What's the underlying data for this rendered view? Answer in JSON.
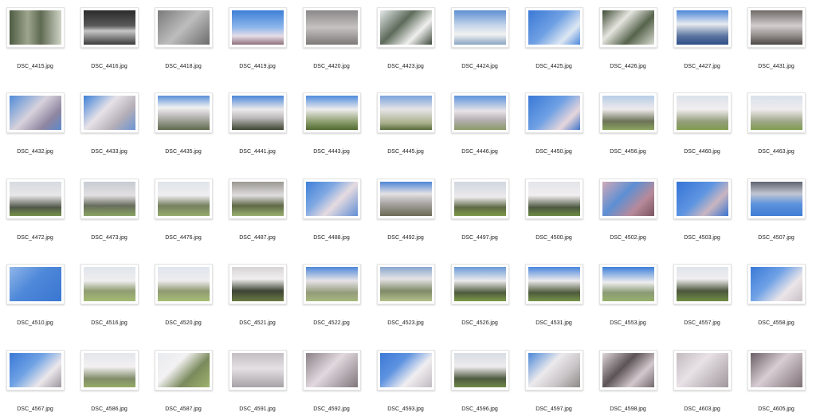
{
  "files": [
    {
      "name": "DSC_4415.jpg",
      "bg": "linear-gradient(90deg,#4d5b43 0%,#9ea58e 35%,#5f6a52 60%,#cfd3c5 100%)"
    },
    {
      "name": "DSC_4416.jpg",
      "bg": "linear-gradient(180deg,#2b2b2b 0%,#5a5a5a 45%,#c7c7c7 60%,#3a3a3a 100%)"
    },
    {
      "name": "DSC_4418.jpg",
      "bg": "linear-gradient(135deg,#7a7a7a 0%,#bdbdbd 50%,#6c6c6c 100%)"
    },
    {
      "name": "DSC_4419.jpg",
      "bg": "linear-gradient(180deg,#3d7fd6 0%,#8eb7eb 50%,#e6dde6 75%,#8d6f7a 100%)"
    },
    {
      "name": "DSC_4420.jpg",
      "bg": "linear-gradient(180deg,#8a8888 0%,#c6c2c2 50%,#7c7878 100%)"
    },
    {
      "name": "DSC_4423.jpg",
      "bg": "linear-gradient(135deg,#e4e8ea 0%,#5d6b5a 40%,#f0f0ee 70%,#3f4a3d 100%)"
    },
    {
      "name": "DSC_4424.jpg",
      "bg": "linear-gradient(180deg,#5e8fd1 0%,#c8d7ea 45%,#f2f2f0 70%,#8aa4c2 100%)"
    },
    {
      "name": "DSC_4425.jpg",
      "bg": "linear-gradient(135deg,#3a78d6 0%,#6fa0e3 45%,#dde7f3 75%,#4c87da 100%)"
    },
    {
      "name": "DSC_4426.jpg",
      "bg": "linear-gradient(135deg,#3d4a34 0%,#e6e6e0 35%,#56634b 65%,#d9dcd2 100%)"
    },
    {
      "name": "DSC_4427.jpg",
      "bg": "linear-gradient(180deg,#4b86d8 0%,#e8ebf0 40%,#5a74a0 75%,#2e4e86 100%)"
    },
    {
      "name": "DSC_4431.jpg",
      "bg": "linear-gradient(180deg,#6f6a66 0%,#d3cdcf 45%,#8f8987 75%,#4c4744 100%)"
    },
    {
      "name": "DSC_4432.jpg",
      "bg": "linear-gradient(135deg,#4f8bd8 0%,#d7d2dc 45%,#8f86a0 75%,#5c88cc 100%)"
    },
    {
      "name": "DSC_4433.jpg",
      "bg": "linear-gradient(135deg,#3d7fd6 0%,#e6e2e8 40%,#b5aeb7 70%,#6b94d3 100%)"
    },
    {
      "name": "DSC_4435.jpg",
      "bg": "linear-gradient(180deg,#5a90d8 0%,#f2f2f2 35%,#c8c5c6 55%,#5f6a4e 100%)"
    },
    {
      "name": "DSC_4441.jpg",
      "bg": "linear-gradient(180deg,#4b86d8 0%,#eceaea 40%,#bcbaba 65%,#3e4633 100%)"
    },
    {
      "name": "DSC_4443.jpg",
      "bg": "linear-gradient(180deg,#4f8bdc 0%,#eeedee 40%,#8fa072 75%,#506a2f 100%)"
    },
    {
      "name": "DSC_4445.jpg",
      "bg": "linear-gradient(180deg,#7aa4dc 0%,#e7e4e7 40%,#a9b08c 80%,#586b3b 100%)"
    },
    {
      "name": "DSC_4446.jpg",
      "bg": "linear-gradient(180deg,#5f95dc 0%,#e8e3e7 45%,#b7b0b5 70%,#8a9a66 100%)"
    },
    {
      "name": "DSC_4450.jpg",
      "bg": "linear-gradient(135deg,#3a78d6 0%,#6ea0e4 45%,#e6d6dc 75%,#3f74c8 100%)"
    },
    {
      "name": "DSC_4456.jpg",
      "bg": "linear-gradient(180deg,#b7cde6 0%,#eeeaec 40%,#6c7357 75%,#8aa35e 100%)"
    },
    {
      "name": "DSC_4460.jpg",
      "bg": "linear-gradient(180deg,#dbe2ea 0%,#f1eef0 40%,#959f7c 75%,#7f9b4f 100%)"
    },
    {
      "name": "DSC_4463.jpg",
      "bg": "linear-gradient(180deg,#d9e1ea 0%,#efecee 40%,#9fa889 75%,#7e9b4f 100%)"
    },
    {
      "name": "DSC_4472.jpg",
      "bg": "linear-gradient(180deg,#d6dae0 0%,#e8e6e8 40%,#505749 75%,#77914a 100%)"
    },
    {
      "name": "DSC_4473.jpg",
      "bg": "linear-gradient(180deg,#c7ccd3 0%,#e2dfe1 40%,#676d5d 70%,#8aa362 100%)"
    },
    {
      "name": "DSC_4476.jpg",
      "bg": "linear-gradient(180deg,#dfe4ea 0%,#efedef 40%,#76815f 70%,#95ab6d 100%)"
    },
    {
      "name": "DSC_4487.jpg",
      "bg": "linear-gradient(180deg,#9a9890 0%,#e0dde0 40%,#5f6a48 70%,#9aaf71 100%)"
    },
    {
      "name": "DSC_4488.jpg",
      "bg": "linear-gradient(135deg,#3f7fd8 0%,#7fa8e2 35%,#e6dbe0 60%,#5f8ed4 100%)"
    },
    {
      "name": "DSC_4492.jpg",
      "bg": "linear-gradient(180deg,#4e85d4 0%,#e4e1e4 35%,#a5a2a0 65%,#6c6a55 100%)"
    },
    {
      "name": "DSC_4497.jpg",
      "bg": "linear-gradient(180deg,#d0d7e0 0%,#ece9eb 45%,#5e6a46 75%,#7f9a4a 100%)"
    },
    {
      "name": "DSC_4500.jpg",
      "bg": "linear-gradient(180deg,#e3e5e9 0%,#f1eef0 40%,#4c5840 75%,#6d8a43 100%)"
    },
    {
      "name": "DSC_4502.jpg",
      "bg": "linear-gradient(135deg,#d1a9b8 0%,#5d8fd3 40%,#b68a9a 70%,#7a5260 100%)"
    },
    {
      "name": "DSC_4503.jpg",
      "bg": "linear-gradient(135deg,#3574d6 0%,#5f95e1 45%,#c9b6c0 70%,#3b74cf 100%)"
    },
    {
      "name": "DSC_4507.jpg",
      "bg": "linear-gradient(180deg,#5f6470 0%,#c2c6d2 35%,#5d93dc 65%,#3f7cd4 100%)"
    },
    {
      "name": "DSC_4510.jpg",
      "bg": "linear-gradient(135deg,#8fb5e8 0%,#4e88d9 45%,#3a76d1 100%)"
    },
    {
      "name": "DSC_4516.jpg",
      "bg": "linear-gradient(180deg,#dfe5ec 0%,#f0eef0 40%,#8f9d71 70%,#a4bb73 100%)"
    },
    {
      "name": "DSC_4520.jpg",
      "bg": "linear-gradient(180deg,#e0e6ee 0%,#eeecee 40%,#8f9a72 70%,#a5bd74 100%)"
    },
    {
      "name": "DSC_4521.jpg",
      "bg": "linear-gradient(180deg,#d7d4d6 0%,#f1eff0 35%,#3d4434 70%,#6b7a43 100%)"
    },
    {
      "name": "DSC_4522.jpg",
      "bg": "linear-gradient(180deg,#4e88da 0%,#e6e3e6 40%,#939c7a 75%,#a7b77c 100%)"
    },
    {
      "name": "DSC_4523.jpg",
      "bg": "linear-gradient(180deg,#8aa7cf 0%,#e6e3e5 35%,#7f8a68 70%,#b3c08a 100%)"
    },
    {
      "name": "DSC_4526.jpg",
      "bg": "linear-gradient(180deg,#6b9ad8 0%,#ecebec 40%,#4f5b3e 75%,#7c9a48 100%)"
    },
    {
      "name": "DSC_4531.jpg",
      "bg": "linear-gradient(180deg,#4a86dd 0%,#eceaec 40%,#4d5a3b 75%,#77944a 100%)"
    },
    {
      "name": "DSC_4553.jpg",
      "bg": "linear-gradient(180deg,#3d7fd8 0%,#eeedef 45%,#8a9a75 75%,#97b06c 100%)"
    },
    {
      "name": "DSC_4557.jpg",
      "bg": "linear-gradient(180deg,#dfe4ea 0%,#f0eef0 35%,#4c573d 70%,#6f8c43 100%)"
    },
    {
      "name": "DSC_4558.jpg",
      "bg": "linear-gradient(135deg,#3a78d6 0%,#6fa2e6 40%,#ebe5e8 70%,#c8c0c6 100%)"
    },
    {
      "name": "DSC_4567.jpg",
      "bg": "linear-gradient(135deg,#3a78d6 0%,#6fa2e4 40%,#ebe7ea 70%,#9b96a0 100%)"
    },
    {
      "name": "DSC_4586.jpg",
      "bg": "linear-gradient(180deg,#e4e6ea 0%,#f2f0f1 40%,#818b69 75%,#95ab66 100%)"
    },
    {
      "name": "DSC_4587.jpg",
      "bg": "linear-gradient(135deg,#e8ebef 0%,#f3f1f2 35%,#7a8a5c 65%,#9fb36e 100%)"
    },
    {
      "name": "DSC_4591.jpg",
      "bg": "linear-gradient(180deg,#c2bfc2 0%,#e4e0e3 45%,#a7a2a6 100%)"
    },
    {
      "name": "DSC_4592.jpg",
      "bg": "linear-gradient(135deg,#8b8288 0%,#e1d9de 45%,#7e767b 100%)"
    },
    {
      "name": "DSC_4593.jpg",
      "bg": "linear-gradient(135deg,#3a78d6 0%,#5f93e0 35%,#f0eef0 65%,#c0bac0 100%)"
    },
    {
      "name": "DSC_4596.jpg",
      "bg": "linear-gradient(180deg,#d8dde4 0%,#eeebed 40%,#4e5a3f 75%,#6f8a46 100%)"
    },
    {
      "name": "DSC_4597.jpg",
      "bg": "linear-gradient(135deg,#4a86d8 0%,#eceaec 40%,#c7c2c5 70%,#8b8a86 100%)"
    },
    {
      "name": "DSC_4598.jpg",
      "bg": "linear-gradient(135deg,#dfd6da 0%,#5b5356 40%,#d2c8cd 70%,#72696d 100%)"
    },
    {
      "name": "DSC_4603.jpg",
      "bg": "linear-gradient(135deg,#c1babe 0%,#e8e1e5 40%,#9f979b 100%)"
    },
    {
      "name": "DSC_4605.jpg",
      "bg": "linear-gradient(135deg,#6b5e66 0%,#d8cdd3 45%,#7d7176 100%)"
    }
  ]
}
